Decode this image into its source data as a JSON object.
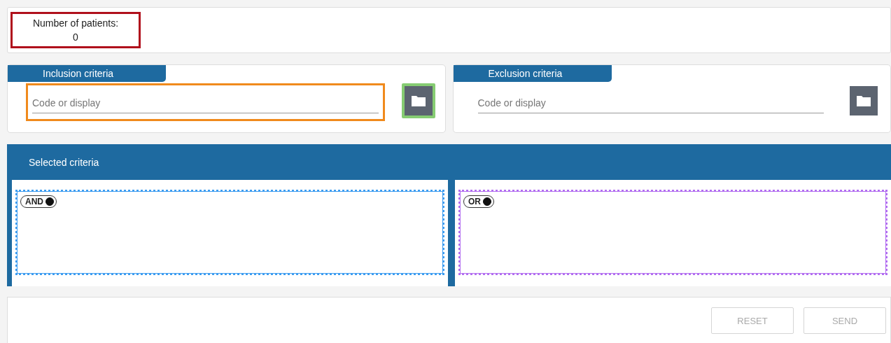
{
  "patient_count": {
    "label": "Number of patients:",
    "value": "0"
  },
  "criteria_panels": [
    {
      "title": "Inclusion criteria",
      "placeholder": "Code or display",
      "highlighted": true
    },
    {
      "title": "Exclusion criteria",
      "placeholder": "Code or display",
      "highlighted": false
    }
  ],
  "selected_criteria": {
    "title": "Selected criteria",
    "groups": [
      {
        "operator": "AND",
        "on": true
      },
      {
        "operator": "OR",
        "on": true
      }
    ]
  },
  "buttons": [
    {
      "label": "RESET",
      "disabled": true
    },
    {
      "label": "SEND",
      "disabled": true
    }
  ]
}
